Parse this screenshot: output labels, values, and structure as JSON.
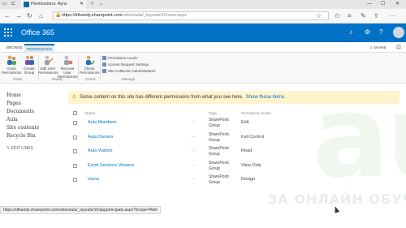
{
  "browser": {
    "tab_title": "Permissions: Ayra",
    "tab_close": "✕",
    "url_host": "https://dihandy.sharepoint.com",
    "url_path": "/sites/aula/_layouts/15/user.aspx",
    "window_controls": [
      "—",
      "☐",
      "✕"
    ]
  },
  "suite": {
    "brand": "Office 365"
  },
  "ribbon_tabs": {
    "browse": "BROWSE",
    "permissions": "PERMISSIONS",
    "share": "SHARE"
  },
  "ribbon": {
    "grant_permissions": "Grant Permissions",
    "create_group": "Create Group",
    "edit_user_permissions": "Edit User Permissions",
    "remove_user_permissions": "Remove User Permissions",
    "check_permissions": "Check Permissions",
    "permission_levels": "Permission Levels",
    "access_request_settings": "Access Request Settings",
    "site_collection_admins": "Site Collection Administrators",
    "group_grant": "Grant",
    "group_modify": "Modify",
    "group_check": "Check",
    "group_manage": "Manage"
  },
  "left_nav": {
    "items": [
      "Home",
      "Pages",
      "Documents",
      "Aula",
      "Site contents",
      "Recycle Bin"
    ],
    "edit_links": "EDIT LINKS"
  },
  "banner": {
    "text": "Some content on this site has different permissions from what you see here.",
    "link": "Show these items."
  },
  "table": {
    "headers": {
      "name": "Name",
      "type": "Type",
      "level": "Permission Levels"
    },
    "rows": [
      {
        "name": "Aula Members",
        "type": "SharePoint Group",
        "level": "Edit"
      },
      {
        "name": "Aula Owners",
        "type": "SharePoint Group",
        "level": "Full Control"
      },
      {
        "name": "Aula Visitors",
        "type": "SharePoint Group",
        "level": "Read"
      },
      {
        "name": "Excel Services Viewers",
        "type": "SharePoint Group",
        "level": "View Only"
      },
      {
        "name": "Users",
        "type": "SharePoint Group",
        "level": "Design"
      }
    ],
    "ellipsis": "..."
  },
  "status_url": "https://dihandy.sharepoint.com/sites/aula/_layouts/15/appprincipals.aspx?Scope=Web",
  "watermark": {
    "logo": "aula",
    "tagline": "ЗА ОНЛАЙН ОБУЧ"
  },
  "colors": {
    "suite_blue": "#0072c6",
    "banner_yellow": "#fff4ce",
    "link": "#0072c6"
  },
  "icons": [
    "waffle-icon",
    "bell-icon",
    "gear-icon",
    "help-icon",
    "avatar",
    "back-icon",
    "forward-icon",
    "refresh-icon",
    "home-icon",
    "favorite-icon",
    "hub-icon",
    "share-icon",
    "more-icon"
  ]
}
